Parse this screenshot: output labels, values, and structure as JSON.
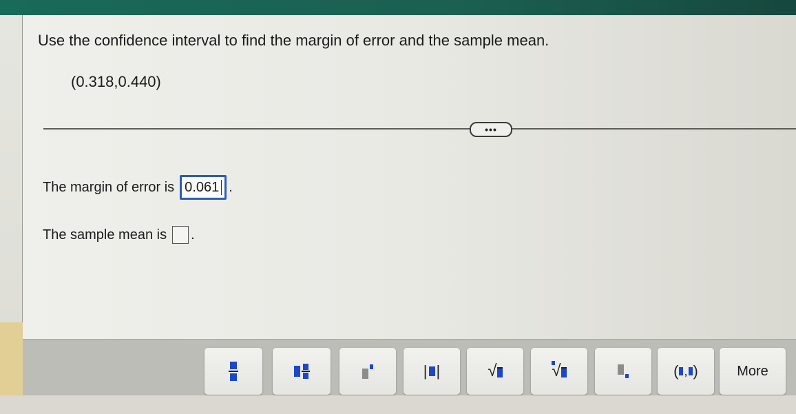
{
  "question": {
    "prompt": "Use the confidence interval to find the margin of error and the sample mean.",
    "interval": "(0.318,0.440)"
  },
  "divider": {
    "expand_label": "•••"
  },
  "answers": {
    "margin_label": "The margin of error is",
    "margin_value": "0.061",
    "mean_label": "The sample mean is",
    "mean_value": "",
    "period": "."
  },
  "toolbar": {
    "buttons": [
      {
        "name": "fraction",
        "icon": "fraction-icon"
      },
      {
        "name": "mixed-number",
        "icon": "mixed-number-icon"
      },
      {
        "name": "exponent",
        "icon": "exponent-icon"
      },
      {
        "name": "absolute-value",
        "icon": "absolute-value-icon"
      },
      {
        "name": "square-root",
        "icon": "square-root-icon"
      },
      {
        "name": "nth-root",
        "icon": "nth-root-icon"
      },
      {
        "name": "subscript",
        "icon": "subscript-icon"
      },
      {
        "name": "ordered-pair",
        "icon": "ordered-pair-icon"
      }
    ],
    "more_label": "More",
    "abs_left": "|",
    "abs_right": "|",
    "sqrt_sign": "√",
    "paren_open": "(",
    "paren_close": ")",
    "comma": ","
  },
  "colors": {
    "header": "#1b5f50",
    "accent": "#2d5db0",
    "placeholder_blue": "#1d47c8"
  }
}
